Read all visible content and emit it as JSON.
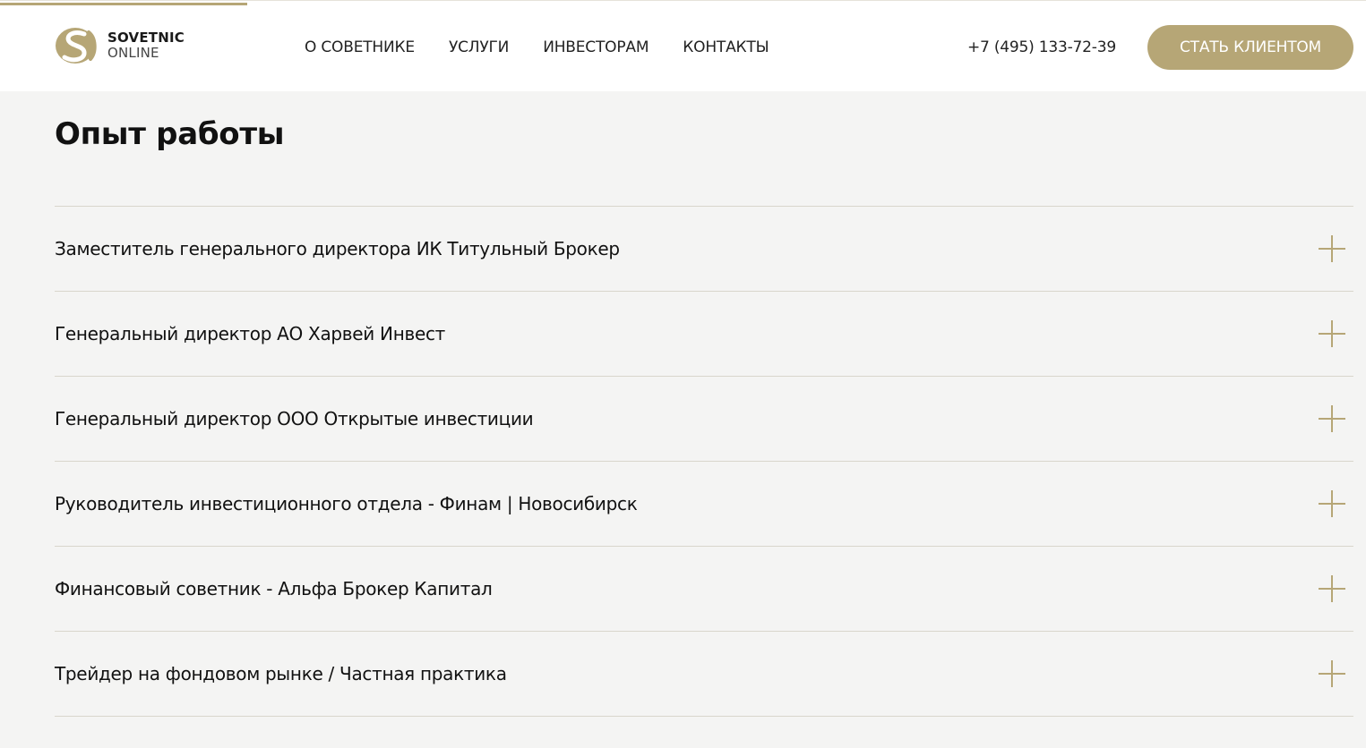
{
  "header": {
    "logo": {
      "top": "SOVETNIC",
      "bottom": "ONLINE",
      "icon": "s-letter-logo-icon"
    },
    "nav": [
      {
        "label": "О СОВЕТНИКЕ"
      },
      {
        "label": "УСЛУГИ"
      },
      {
        "label": "ИНВЕСТОРАМ"
      },
      {
        "label": "КОНТАКТЫ"
      }
    ],
    "phone": "+7 (495) 133-72-39",
    "cta_label": "СТАТЬ КЛИЕНТОМ"
  },
  "main": {
    "title": "Опыт работы",
    "experience": [
      {
        "label": "Заместитель генерального директора ИК Титульный Брокер",
        "icon": "plus-icon"
      },
      {
        "label": "Генеральный директор АО Харвей Инвест",
        "icon": "plus-icon"
      },
      {
        "label": "Генеральный директор ООО Открытые инвестиции",
        "icon": "plus-icon"
      },
      {
        "label": "Руководитель инвестиционного отдела - Финам | Новосибирск",
        "icon": "plus-icon"
      },
      {
        "label": "Финансовый советник - Альфа Брокер Капитал",
        "icon": "plus-icon"
      },
      {
        "label": "Трейдер на фондовом рынке / Частная практика",
        "icon": "plus-icon"
      }
    ]
  },
  "colors": {
    "accent": "#b6a676",
    "background": "#f4f4f3",
    "header_background": "#ffffff",
    "divider": "#d9d6cc",
    "text": "#111111"
  }
}
